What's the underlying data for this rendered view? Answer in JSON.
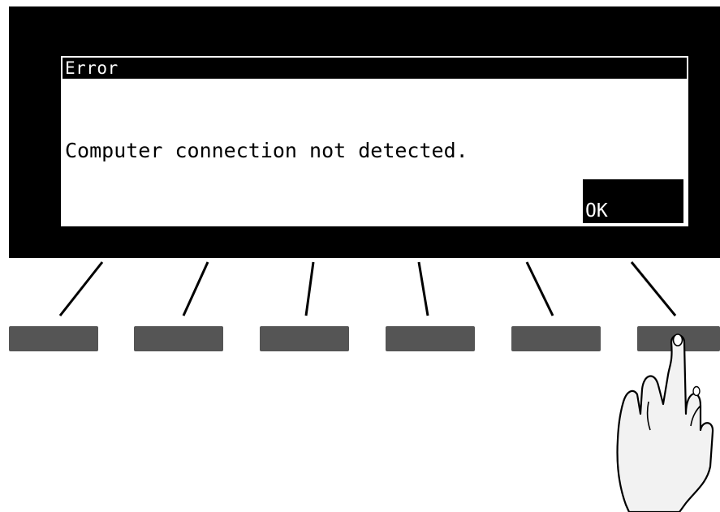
{
  "dialog": {
    "title": "Error",
    "message": "Computer connection not detected.",
    "ok_label": "OK"
  },
  "soft_keys": [
    {
      "name": "soft-key-1"
    },
    {
      "name": "soft-key-2"
    },
    {
      "name": "soft-key-3"
    },
    {
      "name": "soft-key-4"
    },
    {
      "name": "soft-key-5"
    },
    {
      "name": "soft-key-6"
    }
  ],
  "colors": {
    "bezel": "#000000",
    "screen": "#ffffff",
    "soft_key": "#555555"
  },
  "icons": {
    "pointer": "pointing-hand-icon"
  }
}
